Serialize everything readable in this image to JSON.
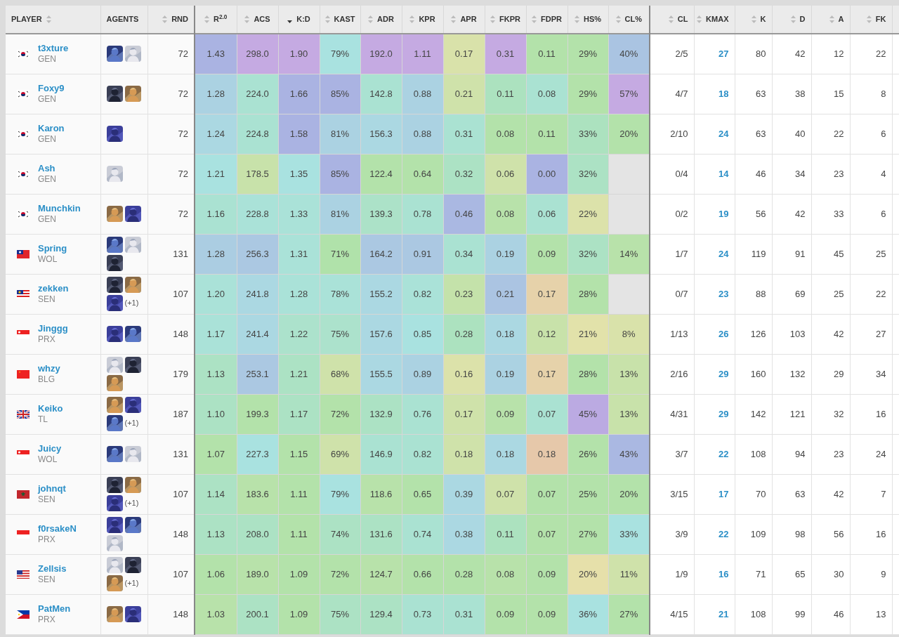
{
  "columns": [
    {
      "label": "PLAYER",
      "sortable": true,
      "sorted": false
    },
    {
      "label": "AGENTS",
      "sortable": false
    },
    {
      "label": "RND",
      "sortable": true,
      "sorted": false
    },
    {
      "label": "R$^{2.0}$",
      "sortable": true,
      "sorted": false
    },
    {
      "label": "ACS",
      "sortable": true,
      "sorted": false
    },
    {
      "label": "K:D",
      "sortable": true,
      "sorted": true
    },
    {
      "label": "KAST",
      "sortable": true,
      "sorted": false
    },
    {
      "label": "ADR",
      "sortable": true,
      "sorted": false
    },
    {
      "label": "KPR",
      "sortable": true,
      "sorted": false
    },
    {
      "label": "APR",
      "sortable": true,
      "sorted": false
    },
    {
      "label": "FKPR",
      "sortable": true,
      "sorted": false
    },
    {
      "label": "FDPR",
      "sortable": true,
      "sorted": false
    },
    {
      "label": "HS%",
      "sortable": true,
      "sorted": false
    },
    {
      "label": "CL%",
      "sortable": true,
      "sorted": false
    },
    {
      "label": "CL",
      "sortable": true,
      "sorted": false
    },
    {
      "label": "KMAX",
      "sortable": true,
      "sorted": false
    },
    {
      "label": "K",
      "sortable": true,
      "sorted": false
    },
    {
      "label": "D",
      "sortable": true,
      "sorted": false
    },
    {
      "label": "A",
      "sortable": true,
      "sorted": false
    },
    {
      "label": "FK",
      "sortable": true,
      "sorted": false
    }
  ],
  "rows": [
    {
      "flag": {
        "kind": "kr"
      },
      "name": "t3xture",
      "team": "GEN",
      "rnd": "72",
      "stats": [
        {
          "value": "1.43",
          "color": "#aab3e2"
        },
        {
          "value": "298.0",
          "color": "#c5aae2"
        },
        {
          "value": "1.90",
          "color": "#c5aae2"
        },
        {
          "value": "79%",
          "color": "#a9e2e0"
        },
        {
          "value": "192.0",
          "color": "#c5aae2"
        },
        {
          "value": "1.11",
          "color": "#c5aae2"
        },
        {
          "value": "0.17",
          "color": "#d9e2aa"
        },
        {
          "value": "0.31",
          "color": "#c5aae2"
        },
        {
          "value": "0.11",
          "color": "#b3e2aa"
        },
        {
          "value": "29%",
          "color": "#b3e2aa"
        },
        {
          "value": "40%",
          "color": "#aac4e2"
        }
      ],
      "cl": "2/5",
      "kmax": "27",
      "k": "80",
      "d": "42",
      "a": "12",
      "fk": "22"
    },
    {
      "flag": {
        "kind": "kr"
      },
      "name": "Foxy9",
      "team": "GEN",
      "rnd": "72",
      "stats": [
        {
          "value": "1.28",
          "color": "#abd2e2"
        },
        {
          "value": "224.0",
          "color": "#aae2d2"
        },
        {
          "value": "1.66",
          "color": "#aab3e2"
        },
        {
          "value": "85%",
          "color": "#aab3e2"
        },
        {
          "value": "142.8",
          "color": "#aae2d2"
        },
        {
          "value": "0.88",
          "color": "#abd2e2"
        },
        {
          "value": "0.21",
          "color": "#cfe2aa"
        },
        {
          "value": "0.11",
          "color": "#ace2bf"
        },
        {
          "value": "0.08",
          "color": "#aae2d2"
        },
        {
          "value": "29%",
          "color": "#b3e2aa"
        },
        {
          "value": "57%",
          "color": "#c5aae2"
        }
      ],
      "cl": "4/7",
      "kmax": "18",
      "k": "63",
      "d": "38",
      "a": "15",
      "fk": "8"
    },
    {
      "flag": {
        "kind": "kr"
      },
      "name": "Karon",
      "team": "GEN",
      "rnd": "72",
      "stats": [
        {
          "value": "1.24",
          "color": "#abd8e2"
        },
        {
          "value": "224.8",
          "color": "#aae2d2"
        },
        {
          "value": "1.58",
          "color": "#aab3e2"
        },
        {
          "value": "81%",
          "color": "#abd2e2"
        },
        {
          "value": "156.3",
          "color": "#abd8e2"
        },
        {
          "value": "0.88",
          "color": "#abd2e2"
        },
        {
          "value": "0.31",
          "color": "#aae2d2"
        },
        {
          "value": "0.08",
          "color": "#b3e2aa"
        },
        {
          "value": "0.11",
          "color": "#b3e2aa"
        },
        {
          "value": "33%",
          "color": "#ace2bf"
        },
        {
          "value": "20%",
          "color": "#b3e2aa"
        }
      ],
      "cl": "2/10",
      "kmax": "24",
      "k": "63",
      "d": "40",
      "a": "22",
      "fk": "6"
    },
    {
      "flag": {
        "kind": "kr"
      },
      "name": "Ash",
      "team": "GEN",
      "rnd": "72",
      "stats": [
        {
          "value": "1.21",
          "color": "#a9e2e0"
        },
        {
          "value": "178.5",
          "color": "#c8e2aa"
        },
        {
          "value": "1.35",
          "color": "#a9e2e0"
        },
        {
          "value": "85%",
          "color": "#aab3e2"
        },
        {
          "value": "122.4",
          "color": "#b3e2aa"
        },
        {
          "value": "0.64",
          "color": "#b3e2aa"
        },
        {
          "value": "0.32",
          "color": "#ace2c4"
        },
        {
          "value": "0.06",
          "color": "#cfe2aa"
        },
        {
          "value": "0.00",
          "color": "#aab3e2"
        },
        {
          "value": "32%",
          "color": "#ace2c4"
        },
        {
          "color": "#e4e4e4"
        }
      ],
      "cl": "0/4",
      "kmax": "14",
      "k": "46",
      "d": "34",
      "a": "23",
      "fk": "4"
    },
    {
      "flag": {
        "kind": "kr"
      },
      "name": "Munchkin",
      "team": "GEN",
      "rnd": "72",
      "stats": [
        {
          "value": "1.16",
          "color": "#aae2d2"
        },
        {
          "value": "228.8",
          "color": "#aae2d8"
        },
        {
          "value": "1.33",
          "color": "#aae2d8"
        },
        {
          "value": "81%",
          "color": "#abd2e2"
        },
        {
          "value": "139.3",
          "color": "#ace2c8"
        },
        {
          "value": "0.78",
          "color": "#aae2d2"
        },
        {
          "value": "0.46",
          "color": "#aab8e2"
        },
        {
          "value": "0.08",
          "color": "#b8e2aa"
        },
        {
          "value": "0.06",
          "color": "#aae2d2"
        },
        {
          "value": "22%",
          "color": "#dce2aa"
        },
        {
          "color": "#e4e4e4"
        }
      ],
      "cl": "0/2",
      "kmax": "19",
      "k": "56",
      "d": "42",
      "a": "33",
      "fk": "6"
    },
    {
      "flag": {
        "kind": "tw"
      },
      "name": "Spring",
      "team": "WOL",
      "rnd": "131",
      "stats": [
        {
          "value": "1.28",
          "color": "#abcde2"
        },
        {
          "value": "256.3",
          "color": "#abc8e2"
        },
        {
          "value": "1.31",
          "color": "#aae2d8"
        },
        {
          "value": "71%",
          "color": "#b0e2aa"
        },
        {
          "value": "164.2",
          "color": "#abc8e2"
        },
        {
          "value": "0.91",
          "color": "#abc8e2"
        },
        {
          "value": "0.34",
          "color": "#aae2d2"
        },
        {
          "value": "0.19",
          "color": "#abd2e2"
        },
        {
          "value": "0.09",
          "color": "#b3e2aa"
        },
        {
          "value": "32%",
          "color": "#ace2c4"
        },
        {
          "value": "14%",
          "color": "#b8e2aa"
        }
      ],
      "cl": "1/7",
      "kmax": "24",
      "k": "119",
      "d": "91",
      "a": "45",
      "fk": "25"
    },
    {
      "flag": {
        "kind": "my"
      },
      "name": "zekken",
      "team": "SEN",
      "more": "(+1)",
      "rnd": "107",
      "stats": [
        {
          "value": "1.20",
          "color": "#aae2d8"
        },
        {
          "value": "241.8",
          "color": "#abd8e2"
        },
        {
          "value": "1.28",
          "color": "#aae2d8"
        },
        {
          "value": "78%",
          "color": "#aae2d8"
        },
        {
          "value": "155.2",
          "color": "#abd8e2"
        },
        {
          "value": "0.82",
          "color": "#aae2d8"
        },
        {
          "value": "0.23",
          "color": "#c4e2aa"
        },
        {
          "value": "0.21",
          "color": "#abc4e2"
        },
        {
          "value": "0.17",
          "color": "#e6d2aa"
        },
        {
          "value": "28%",
          "color": "#b3e2aa"
        },
        {
          "color": "#e4e4e4"
        }
      ],
      "cl": "0/7",
      "kmax": "23",
      "k": "88",
      "d": "69",
      "a": "25",
      "fk": "22"
    },
    {
      "flag": {
        "kind": "sg"
      },
      "name": "Jinggg",
      "team": "PRX",
      "rnd": "148",
      "stats": [
        {
          "value": "1.17",
          "color": "#aae2d8"
        },
        {
          "value": "241.4",
          "color": "#abd8e2"
        },
        {
          "value": "1.22",
          "color": "#ace2cc"
        },
        {
          "value": "75%",
          "color": "#ace2cc"
        },
        {
          "value": "157.6",
          "color": "#abd8e2"
        },
        {
          "value": "0.85",
          "color": "#a9e2e0"
        },
        {
          "value": "0.28",
          "color": "#ace2bf"
        },
        {
          "value": "0.18",
          "color": "#abd8e2"
        },
        {
          "value": "0.12",
          "color": "#c8e2aa"
        },
        {
          "value": "21%",
          "color": "#e2e2aa"
        },
        {
          "value": "8%",
          "color": "#d9e2aa"
        }
      ],
      "cl": "1/13",
      "kmax": "26",
      "k": "126",
      "d": "103",
      "a": "42",
      "fk": "27"
    },
    {
      "flag": {
        "kind": "cn"
      },
      "name": "whzy",
      "team": "BLG",
      "rnd": "179",
      "stats": [
        {
          "value": "1.13",
          "color": "#ace2c4"
        },
        {
          "value": "253.1",
          "color": "#abc8e2"
        },
        {
          "value": "1.21",
          "color": "#ace2c4"
        },
        {
          "value": "68%",
          "color": "#cfe2aa"
        },
        {
          "value": "155.5",
          "color": "#abd8e2"
        },
        {
          "value": "0.89",
          "color": "#abd2e2"
        },
        {
          "value": "0.16",
          "color": "#dce2aa"
        },
        {
          "value": "0.19",
          "color": "#abd2e2"
        },
        {
          "value": "0.17",
          "color": "#e6d2aa"
        },
        {
          "value": "28%",
          "color": "#b3e2aa"
        },
        {
          "value": "13%",
          "color": "#c8e2aa"
        }
      ],
      "cl": "2/16",
      "kmax": "29",
      "k": "160",
      "d": "132",
      "a": "29",
      "fk": "34"
    },
    {
      "flag": {
        "kind": "gb"
      },
      "name": "Keiko",
      "team": "TL",
      "more": "(+1)",
      "rnd": "187",
      "stats": [
        {
          "value": "1.10",
          "color": "#ace2c4"
        },
        {
          "value": "199.3",
          "color": "#b3e2aa"
        },
        {
          "value": "1.17",
          "color": "#ace2c4"
        },
        {
          "value": "72%",
          "color": "#b3e2aa"
        },
        {
          "value": "132.9",
          "color": "#ace2c4"
        },
        {
          "value": "0.76",
          "color": "#aae2d2"
        },
        {
          "value": "0.17",
          "color": "#cfe2aa"
        },
        {
          "value": "0.09",
          "color": "#b8e2aa"
        },
        {
          "value": "0.07",
          "color": "#aae2d2"
        },
        {
          "value": "45%",
          "color": "#bbaae2"
        },
        {
          "value": "13%",
          "color": "#c8e2aa"
        }
      ],
      "cl": "4/31",
      "kmax": "29",
      "k": "142",
      "d": "121",
      "a": "32",
      "fk": "16"
    },
    {
      "flag": {
        "kind": "sg"
      },
      "name": "Juicy",
      "team": "WOL",
      "rnd": "131",
      "stats": [
        {
          "value": "1.07",
          "color": "#b3e2aa"
        },
        {
          "value": "227.3",
          "color": "#a9e2e0"
        },
        {
          "value": "1.15",
          "color": "#b3e2aa"
        },
        {
          "value": "69%",
          "color": "#cfe2aa"
        },
        {
          "value": "146.9",
          "color": "#aae2d2"
        },
        {
          "value": "0.82",
          "color": "#aae2d2"
        },
        {
          "value": "0.18",
          "color": "#cfe2aa"
        },
        {
          "value": "0.18",
          "color": "#abd8e2"
        },
        {
          "value": "0.18",
          "color": "#e6c8aa"
        },
        {
          "value": "26%",
          "color": "#b3e2aa"
        },
        {
          "value": "43%",
          "color": "#aab8e2"
        }
      ],
      "cl": "3/7",
      "kmax": "22",
      "k": "108",
      "d": "94",
      "a": "23",
      "fk": "24"
    },
    {
      "flag": {
        "kind": "ma"
      },
      "name": "johnqt",
      "team": "SEN",
      "more": "(+1)",
      "rnd": "107",
      "stats": [
        {
          "value": "1.14",
          "color": "#ace2c4"
        },
        {
          "value": "183.6",
          "color": "#b8e2aa"
        },
        {
          "value": "1.11",
          "color": "#b3e2aa"
        },
        {
          "value": "79%",
          "color": "#a9e2e0"
        },
        {
          "value": "118.6",
          "color": "#b8e2aa"
        },
        {
          "value": "0.65",
          "color": "#b3e2aa"
        },
        {
          "value": "0.39",
          "color": "#abd8e2"
        },
        {
          "value": "0.07",
          "color": "#cfe2aa"
        },
        {
          "value": "0.07",
          "color": "#b3e2aa"
        },
        {
          "value": "25%",
          "color": "#b3e2aa"
        },
        {
          "value": "20%",
          "color": "#b3e2aa"
        }
      ],
      "cl": "3/15",
      "kmax": "17",
      "k": "70",
      "d": "63",
      "a": "42",
      "fk": "7"
    },
    {
      "flag": {
        "kind": "id"
      },
      "name": "f0rsakeN",
      "team": "PRX",
      "rnd": "148",
      "stats": [
        {
          "value": "1.13",
          "color": "#ace2c4"
        },
        {
          "value": "208.0",
          "color": "#ace2c4"
        },
        {
          "value": "1.11",
          "color": "#b3e2aa"
        },
        {
          "value": "74%",
          "color": "#ace2c4"
        },
        {
          "value": "131.6",
          "color": "#ace2c4"
        },
        {
          "value": "0.74",
          "color": "#aae2d2"
        },
        {
          "value": "0.38",
          "color": "#abd8e2"
        },
        {
          "value": "0.11",
          "color": "#ace2bf"
        },
        {
          "value": "0.07",
          "color": "#b3e2aa"
        },
        {
          "value": "27%",
          "color": "#b3e2aa"
        },
        {
          "value": "33%",
          "color": "#a9e2e0"
        }
      ],
      "cl": "3/9",
      "kmax": "22",
      "k": "109",
      "d": "98",
      "a": "56",
      "fk": "16"
    },
    {
      "flag": {
        "kind": "us"
      },
      "name": "Zellsis",
      "team": "SEN",
      "more": "(+1)",
      "rnd": "107",
      "stats": [
        {
          "value": "1.06",
          "color": "#b3e2aa"
        },
        {
          "value": "189.0",
          "color": "#b8e2aa"
        },
        {
          "value": "1.09",
          "color": "#b3e2aa"
        },
        {
          "value": "72%",
          "color": "#b3e2aa"
        },
        {
          "value": "124.7",
          "color": "#b8e2aa"
        },
        {
          "value": "0.66",
          "color": "#b3e2aa"
        },
        {
          "value": "0.28",
          "color": "#b3e2aa"
        },
        {
          "value": "0.08",
          "color": "#b8e2aa"
        },
        {
          "value": "0.09",
          "color": "#b3e2aa"
        },
        {
          "value": "20%",
          "color": "#e6e0aa"
        },
        {
          "value": "11%",
          "color": "#cfe2aa"
        }
      ],
      "cl": "1/9",
      "kmax": "16",
      "k": "71",
      "d": "65",
      "a": "30",
      "fk": "9"
    },
    {
      "flag": {
        "kind": "ph"
      },
      "name": "PatMen",
      "team": "PRX",
      "rnd": "148",
      "stats": [
        {
          "value": "1.03",
          "color": "#b8e2aa"
        },
        {
          "value": "200.1",
          "color": "#ace2c4"
        },
        {
          "value": "1.09",
          "color": "#b3e2aa"
        },
        {
          "value": "75%",
          "color": "#ace2c4"
        },
        {
          "value": "129.4",
          "color": "#ace2c4"
        },
        {
          "value": "0.73",
          "color": "#aae2d2"
        },
        {
          "value": "0.31",
          "color": "#aae2d2"
        },
        {
          "value": "0.09",
          "color": "#b3e2aa"
        },
        {
          "value": "0.09",
          "color": "#b3e2aa"
        },
        {
          "value": "36%",
          "color": "#a9e2e0"
        },
        {
          "value": "27%",
          "color": "#b3e2aa"
        }
      ],
      "cl": "4/15",
      "kmax": "21",
      "k": "108",
      "d": "99",
      "a": "46",
      "fk": "13"
    }
  ]
}
